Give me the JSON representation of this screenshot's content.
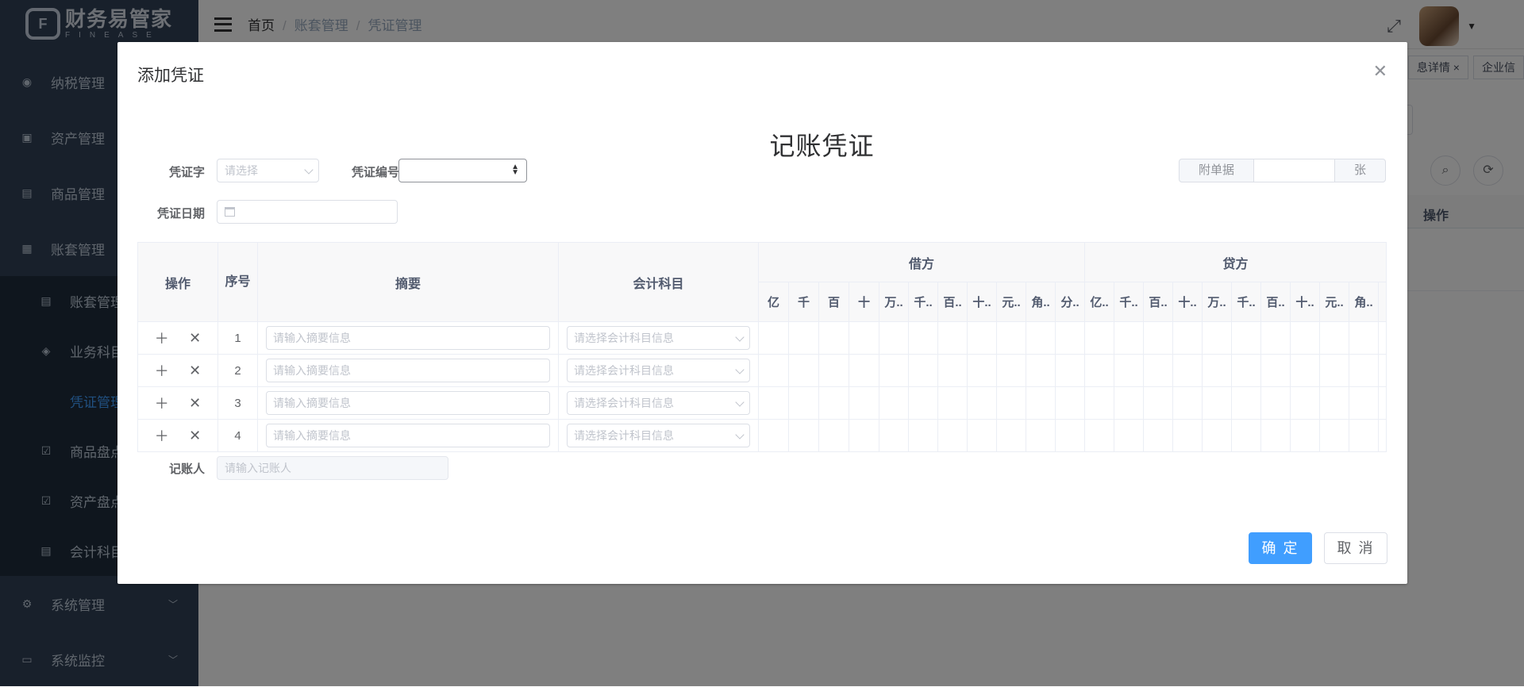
{
  "app": {
    "logo_title": "财务易管家",
    "logo_sub": "FINEASE"
  },
  "sidebar": {
    "items": [
      {
        "label": "纳税管理",
        "icon": "eye-icon"
      },
      {
        "label": "资产管理",
        "icon": "asset-icon"
      },
      {
        "label": "商品管理",
        "icon": "goods-icon"
      },
      {
        "label": "账套管理",
        "icon": "ledger-icon"
      }
    ],
    "sub_items": [
      {
        "label": "账套管理",
        "icon": "doc-icon"
      },
      {
        "label": "业务科目",
        "icon": "layers-icon"
      },
      {
        "label": "凭证管理",
        "icon": "",
        "active": true
      },
      {
        "label": "商品盘点",
        "icon": "check-icon"
      },
      {
        "label": "资产盘点",
        "icon": "check-icon"
      },
      {
        "label": "会计科目",
        "icon": "doc-icon"
      }
    ],
    "bottom_items": [
      {
        "label": "系统管理",
        "icon": "gear-icon"
      },
      {
        "label": "系统监控",
        "icon": "monitor-icon"
      }
    ]
  },
  "breadcrumb": [
    "首页",
    "账套管理",
    "凭证管理"
  ],
  "tags": [
    "息详情 ×",
    "企业信"
  ],
  "background": {
    "reset_label": "重置",
    "op_header": "操作"
  },
  "dialog": {
    "title": "添加凭证",
    "voucher_title": "记账凭证",
    "voucher_word_label": "凭证字",
    "voucher_word_placeholder": "请选择",
    "voucher_no_label": "凭证编号",
    "voucher_no_value": "",
    "voucher_date_label": "凭证日期",
    "attachments_label": "附单据",
    "attachments_value": "",
    "attachments_unit": "张",
    "bookkeeper_label": "记账人",
    "bookkeeper_placeholder": "请输入记账人",
    "confirm_label": "确 定",
    "cancel_label": "取 消"
  },
  "table": {
    "headers": {
      "op": "操作",
      "seq": "序号",
      "summary": "摘要",
      "subject": "会计科目",
      "debit": "借方",
      "credit": "贷方"
    },
    "debit_digits": [
      "亿",
      "千",
      "百",
      "十",
      "万..",
      "千..",
      "百..",
      "十..",
      "元..",
      "角..",
      "分.."
    ],
    "credit_digits": [
      "亿..",
      "千..",
      "百..",
      "十..",
      "万..",
      "千..",
      "百..",
      "十..",
      "元..",
      "角.."
    ],
    "summary_placeholder": "请输入摘要信息",
    "subject_placeholder": "请选择会计科目信息",
    "rows": [
      {
        "seq": "1"
      },
      {
        "seq": "2"
      },
      {
        "seq": "3"
      },
      {
        "seq": "4"
      }
    ]
  }
}
